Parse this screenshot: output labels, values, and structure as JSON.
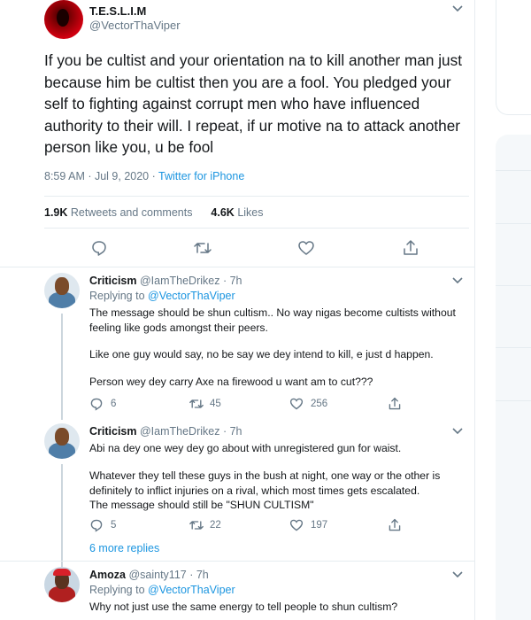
{
  "tweet": {
    "author_name": "T.E.S.L.I.M",
    "author_handle": "@VectorThaViper",
    "text": "If you be cultist and your orientation na to kill another man just because him be cultist then you are a fool. You pledged your self to fighting against corrupt men who have influenced authority to their will. I repeat, if ur motive na to attack another person like you, u be fool",
    "timestamp": "8:59 AM · Jul 9, 2020 · ",
    "source": "Twitter for iPhone",
    "retweets_count": "1.9K",
    "retweets_label": "Retweets and comments",
    "likes_count": "4.6K",
    "likes_label": "Likes"
  },
  "replies": [
    {
      "name": "Criticism",
      "handle": "@IamTheDrikez · 7h",
      "replying_prefix": "Replying to ",
      "replying_to": "@VectorThaViper",
      "paragraphs": [
        "The message should be shun cultism.. No way nigas become cultists without feeling like gods amongst their peers.",
        "Like one guy would say, no be say we dey intend to kill, e just d happen.",
        "Person wey dey carry Axe na firewood u want am to cut???"
      ],
      "replies": "6",
      "retweets": "45",
      "likes": "256"
    },
    {
      "name": "Criticism",
      "handle": "@IamTheDrikez · 7h",
      "paragraphs": [
        "Abi na dey one wey dey go about with unregistered gun for waist.",
        "Whatever they tell these guys in the bush at night, one way or the other is definitely to inflict injuries on a rival, which most times gets escalated.",
        "The message should still be \"SHUN CULTISM\""
      ],
      "replies": "5",
      "retweets": "22",
      "likes": "197"
    },
    {
      "name": "Amoza",
      "handle": "@sainty117 · 7h",
      "replying_prefix": "Replying to ",
      "replying_to": "@VectorThaViper",
      "paragraphs": [
        "Why not just use the same energy to tell people to shun cultism?"
      ]
    }
  ],
  "more_replies": "6 more replies",
  "icons": {
    "reply": "reply-icon",
    "retweet": "retweet-icon",
    "like": "heart-icon",
    "share": "share-icon",
    "menu": "chevron-down-icon"
  },
  "colors": {
    "link": "#1b95e0",
    "secondary_text": "#657786",
    "divider": "#e6ecf0"
  }
}
